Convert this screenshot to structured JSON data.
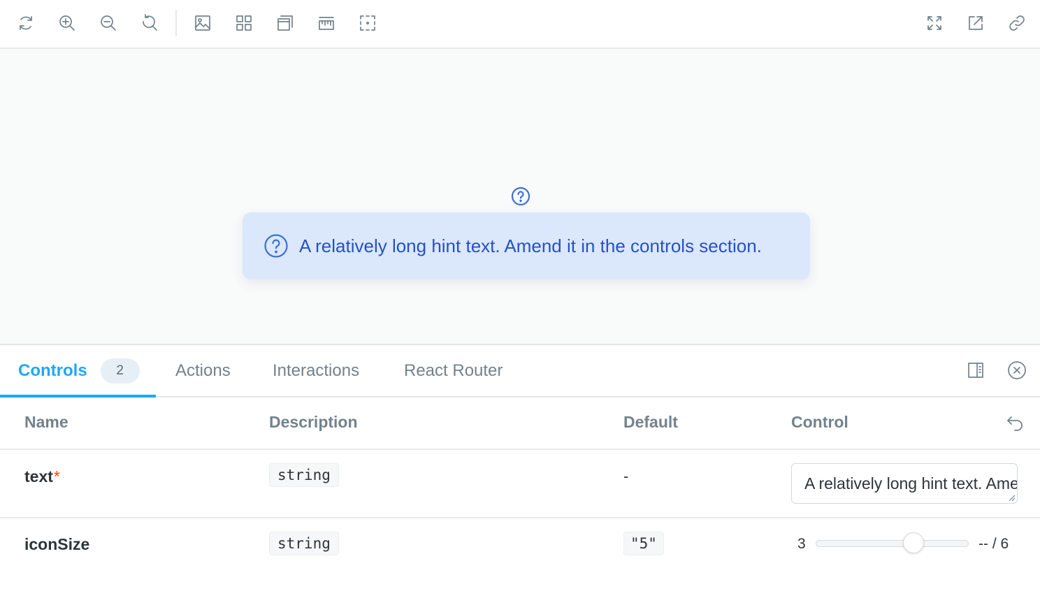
{
  "toolbar": {
    "left_icons": [
      "reload-icon",
      "zoom-in-icon",
      "zoom-out-icon",
      "zoom-reset-icon",
      "background-icon",
      "grid-icon",
      "viewport-icon",
      "measure-icon",
      "outline-icon"
    ],
    "right_icons": [
      "fullscreen-icon",
      "open-new-tab-icon",
      "copy-link-icon"
    ]
  },
  "preview": {
    "hint_text": "A relatively long hint text. Amend it in the controls section.",
    "accent": "#3a6fd8",
    "box_bg": "#dbe8fb"
  },
  "tabs": {
    "items": [
      {
        "label": "Controls",
        "badge": "2",
        "active": true
      },
      {
        "label": "Actions"
      },
      {
        "label": "Interactions"
      },
      {
        "label": "React Router"
      }
    ],
    "active_color": "#1ea7fd"
  },
  "args_table": {
    "columns": [
      "Name",
      "Description",
      "Default",
      "Control"
    ],
    "rows": [
      {
        "name": "text",
        "required_mark": "*",
        "type": "string",
        "default": "-",
        "control_value": "A relatively long hint text. Amend it in the controls section."
      },
      {
        "name": "iconSize",
        "type": "string",
        "default": "\"5\"",
        "range_min": "3",
        "range_value_text": "-- / 6",
        "range_fraction": 0.64
      }
    ]
  }
}
